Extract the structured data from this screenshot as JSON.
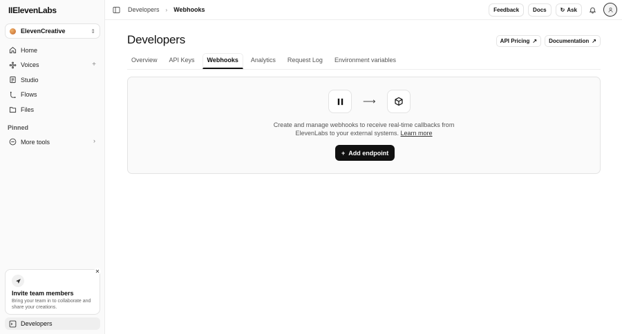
{
  "sidebar": {
    "logo": "IIElevenLabs",
    "workspace": "ElevenCreative",
    "nav": [
      {
        "label": "Home",
        "icon": "home-icon"
      },
      {
        "label": "Voices",
        "icon": "voices-icon"
      },
      {
        "label": "Studio",
        "icon": "studio-icon"
      },
      {
        "label": "Flows",
        "icon": "flows-icon"
      },
      {
        "label": "Files",
        "icon": "files-icon"
      }
    ],
    "pinned_label": "Pinned",
    "more_tools": "More tools",
    "invite": {
      "title": "Invite team members",
      "desc": "Bring your team in to collaborate and share your creations."
    },
    "bottom_item": "Developers"
  },
  "topbar": {
    "crumb1": "Developers",
    "crumb2": "Webhooks",
    "feedback": "Feedback",
    "docs": "Docs",
    "ask": "Ask"
  },
  "header": {
    "title": "Developers",
    "api_pricing": "API Pricing",
    "documentation": "Documentation"
  },
  "tabs": [
    {
      "label": "Overview",
      "active": false
    },
    {
      "label": "API Keys",
      "active": false
    },
    {
      "label": "Webhooks",
      "active": true
    },
    {
      "label": "Analytics",
      "active": false
    },
    {
      "label": "Request Log",
      "active": false
    },
    {
      "label": "Environment variables",
      "active": false
    }
  ],
  "panel": {
    "desc_line1": "Create and manage webhooks to receive real-time callbacks from",
    "desc_line2": "ElevenLabs to your external systems.",
    "learn_more": "Learn more",
    "add_endpoint": "Add endpoint"
  },
  "colors": {
    "accent": "#111111",
    "sidebar_bg": "#fafafa",
    "panel_bg": "#fafafa"
  }
}
